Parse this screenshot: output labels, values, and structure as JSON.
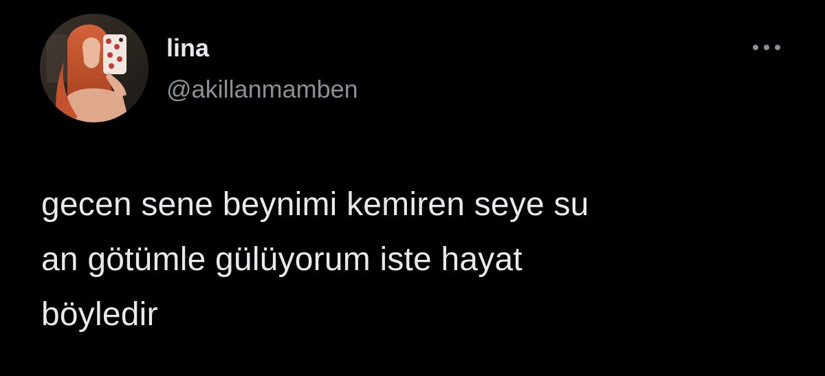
{
  "author": {
    "display_name": "lina",
    "handle": "@akillanmamben",
    "avatar_icon": "profile-photo"
  },
  "menu": {
    "more_icon": "more-horizontal-icon"
  },
  "tweet": {
    "lines": [
      "gecen sene beynimi kemiren seye su",
      "an götümle gülüyorum iste hayat",
      "böyledir"
    ]
  },
  "colors": {
    "background": "#000000",
    "text_primary": "#e7e9ea",
    "text_secondary": "#8b9096"
  }
}
